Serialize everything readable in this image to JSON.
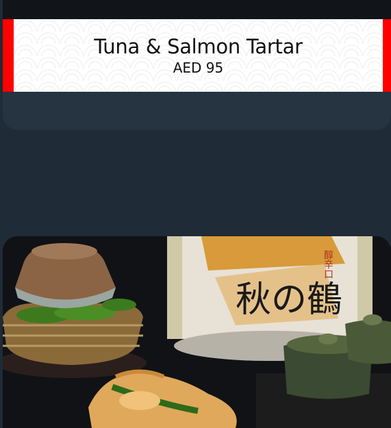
{
  "featured_item": {
    "name": "Tuna & Salmon Tartar",
    "price": "AED 95"
  },
  "next_item": {
    "bottle_label_text": "秋の鶴",
    "bottle_side_text": "醇辛口"
  },
  "colors": {
    "page_background": "#1f2b37",
    "card_background": "#263340",
    "banner_accent": "#ff0000"
  }
}
